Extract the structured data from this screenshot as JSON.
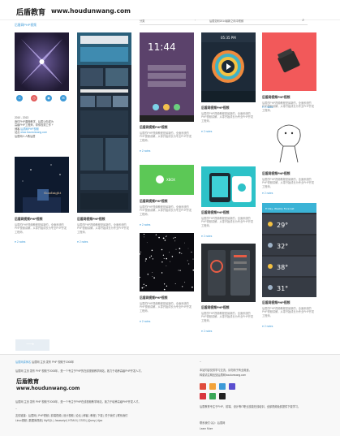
{
  "header": {
    "logo_cn": "后盾教育",
    "logo_url": "www.houdunwang.com"
  },
  "breadcrumb": "后盾网PHP视频",
  "ribbon": {
    "left_label": "分类",
    "middle_label": "后盾如何2014最新之晴中视频",
    "search_icon": "search-icon"
  },
  "profile": {
    "line1": "后盾网的PHP视频",
    "line2": "2010 - 2013",
    "line3": "我们PHP课程教学，后盾让你成为",
    "line4": "高级PHP工程师，帮你找到工作 +",
    "line5": "博客",
    "link1": "后盾网PHP视频",
    "line6": "站点",
    "link2": "www.houdunwang.com",
    "line7": "后盾网人人教后盾",
    "icons": [
      "user-icon",
      "clock-icon",
      "rss-icon",
      "mail-icon"
    ]
  },
  "posts": {
    "title": "后盾网视频PHP视频",
    "desc": "后盾的PHP视频教程是最新的，全面系统的PHP视频讲解，从零开始成长为专业PHP开发工程师。",
    "likes": "2 notes"
  },
  "phone_clock": "11:44",
  "phone_time2": "05:35 PM",
  "weather": {
    "title": "Friday, Weekly Forecast",
    "temps": [
      "29°",
      "32°",
      "38°",
      "31°"
    ]
  },
  "footer": {
    "site_line_label": "后盾网讲师名",
    "site_line_text": "后盾网 主页 发布 PHP 视频于2008年",
    "main_text": "后盾网 主页 发布 PHP 视频于2008年，是一个专注于PHP的在线视频教学网站，致力于培养高级PHP开发人才。",
    "logo_cn": "后盾教育",
    "logo_url": "www.houdunwang.com",
    "desc_text": "后盾网 主页 发布 PHP 视频于2008年，是一个专注于PHP在线视频教学网站，致力于培养高级PHP开发人才。",
    "dash": "--",
    "bottom_links": "友情链接：后盾网 | PHP视频 | 前端视频 | 设计视频 | 论坛 | 博客 | 教程 | 下载 | 关于我们 | 联系我们",
    "bottom_links2": "Linux视频 | 数据库视频 | MySQL | Javascript | HTML5 | CSS3 | jQuery | Ajax",
    "right_title": "--",
    "right_text1": "本站内容仅供学习交流，请勿用于商业用途，",
    "right_text2": "转载请注明出处后盾网houdunwang.com",
    "right_text3": "后盾教育专注于PHP、前端、设计等IT职业技能在线培训，全部视频免费提供下载学习。",
    "right_text4": "联系我们 QQ：后盾网",
    "right_link": "Learn More"
  },
  "colors": {
    "accent": "#3d9ad8",
    "footer_bg": "#f8f8f8"
  }
}
